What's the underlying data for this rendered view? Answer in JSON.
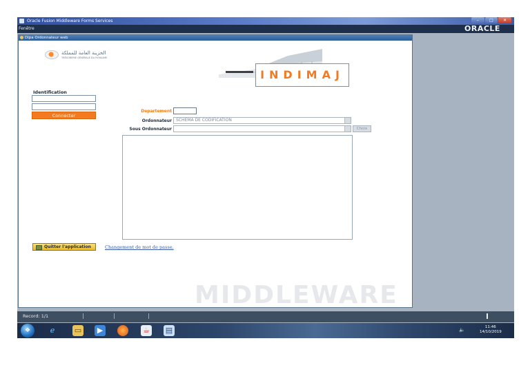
{
  "window": {
    "title": "Oracle Fusion Middleware Forms Services",
    "buttons": [
      "–",
      "□",
      "✕"
    ]
  },
  "menubar": {
    "menu": "Fenêtre",
    "brand": "ORACLE"
  },
  "form": {
    "title": "Dipa Ordonnateur web",
    "logo_arabic": "الخزينة العامة للمملكة",
    "logo_french": "TRÉSORERIE GÉNÉRALE DU ROYAUME",
    "app_name": "INDIMAJ",
    "identification_label": "Identification",
    "connect_label": "Connecter",
    "department_label": "Departement",
    "ordonnateur_label": "Ordonnateur",
    "ordonnateur_value": "SCHEMA DE CODIFICATION",
    "sous_ordonnateur_label": "Sous Ordonnateur",
    "choix_label": "Choix",
    "quit_label": "Quitter l'application",
    "change_password_link": "Changement de mot de passe."
  },
  "watermark": "MIDDLEWARE",
  "statusbar": {
    "record": "Record: 1/1"
  },
  "taskbar": {
    "icons": [
      "start-orb",
      "ie-icon",
      "folder-icon",
      "media-player-icon",
      "firefox-icon",
      "java-icon",
      "forms-icon"
    ],
    "clock_time": "11:46",
    "clock_date": "14/10/2019"
  }
}
